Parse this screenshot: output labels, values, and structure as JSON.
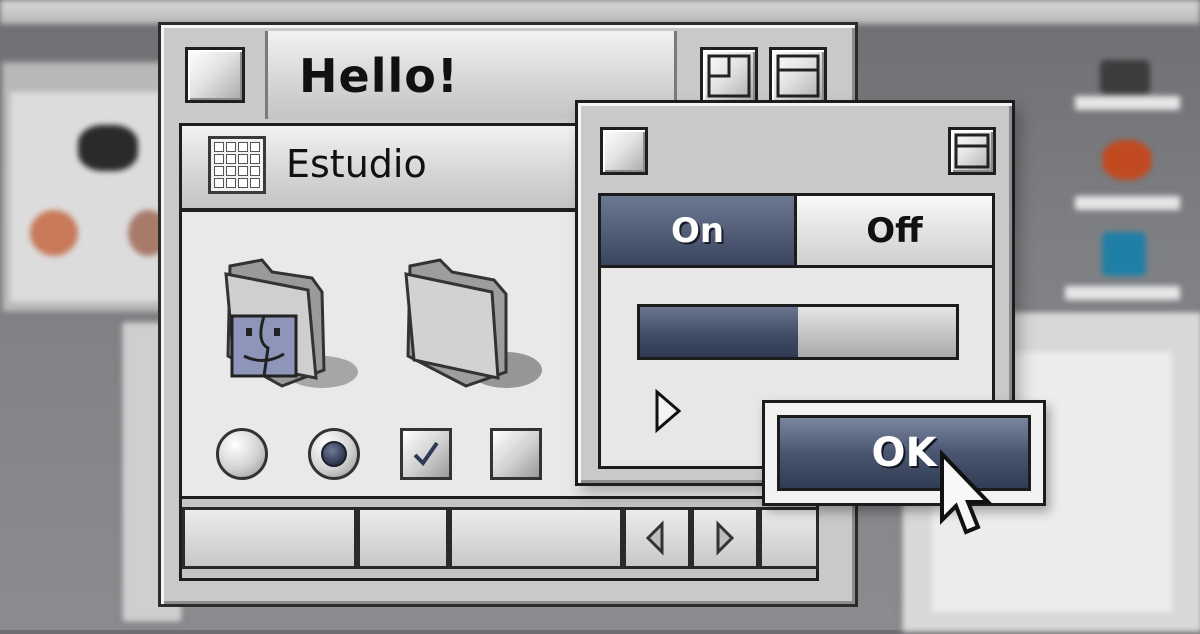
{
  "main_window": {
    "title": "Hello!"
  },
  "folder_window": {
    "title": "Estudio"
  },
  "float_window": {
    "segments": [
      {
        "label": "On",
        "selected": true
      },
      {
        "label": "Off",
        "selected": false
      }
    ],
    "progress_fraction": 0.5
  },
  "controls": {
    "radio_1_selected": false,
    "radio_2_selected": true,
    "checkbox_1_checked": true,
    "checkbox_2_checked": false
  },
  "ok_button": {
    "label": "OK"
  },
  "colors": {
    "accent": "#4a5670",
    "accent_light": "#7b87a0",
    "chrome": "#c9c9c9",
    "content": "#e9e9e9"
  },
  "icons": [
    "window-close-box-icon",
    "window-zoom-box-icon",
    "window-collapse-box-icon",
    "grid-view-icon",
    "finder-folder-icon",
    "folder-icon",
    "disclosure-triangle-icon",
    "scroll-left-arrow-icon",
    "scroll-right-arrow-icon",
    "arrow-cursor-icon"
  ]
}
